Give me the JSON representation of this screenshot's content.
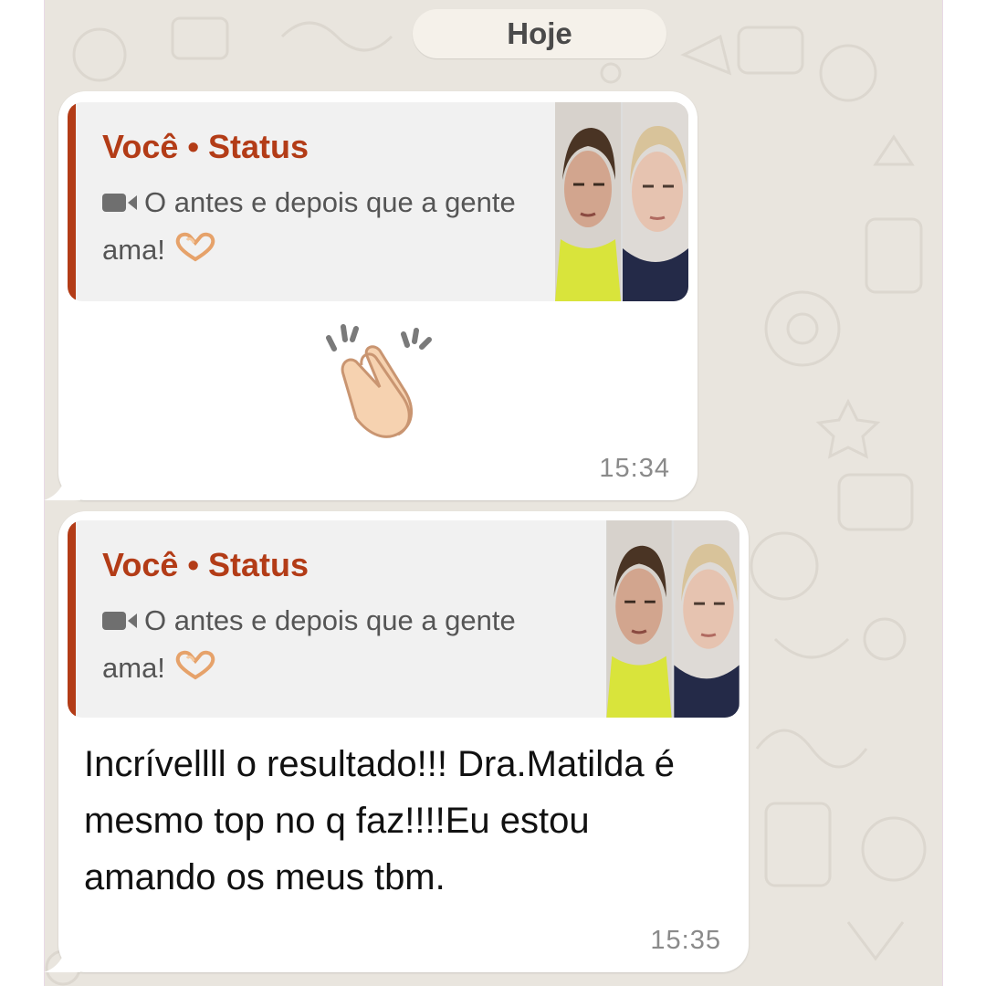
{
  "date_separator": "Hoje",
  "messages": [
    {
      "reply": {
        "author": "Você • Status",
        "text": "O antes e depois que a gente ama!"
      },
      "emoji": "clapping-hands",
      "time": "15:34"
    },
    {
      "reply": {
        "author": "Você • Status",
        "text": "O antes e depois que a gente ama!"
      },
      "text": "Incrívellll o resultado!!! Dra.Matilda é mesmo top no q faz!!!!Eu estou amando os meus tbm.",
      "time": "15:35"
    }
  ],
  "colors": {
    "chat_background": "#e9e5de",
    "bubble": "#ffffff",
    "quote_accent": "#b33c17",
    "quote_background": "#f1f1f1",
    "timestamp": "#8a8a8a"
  }
}
